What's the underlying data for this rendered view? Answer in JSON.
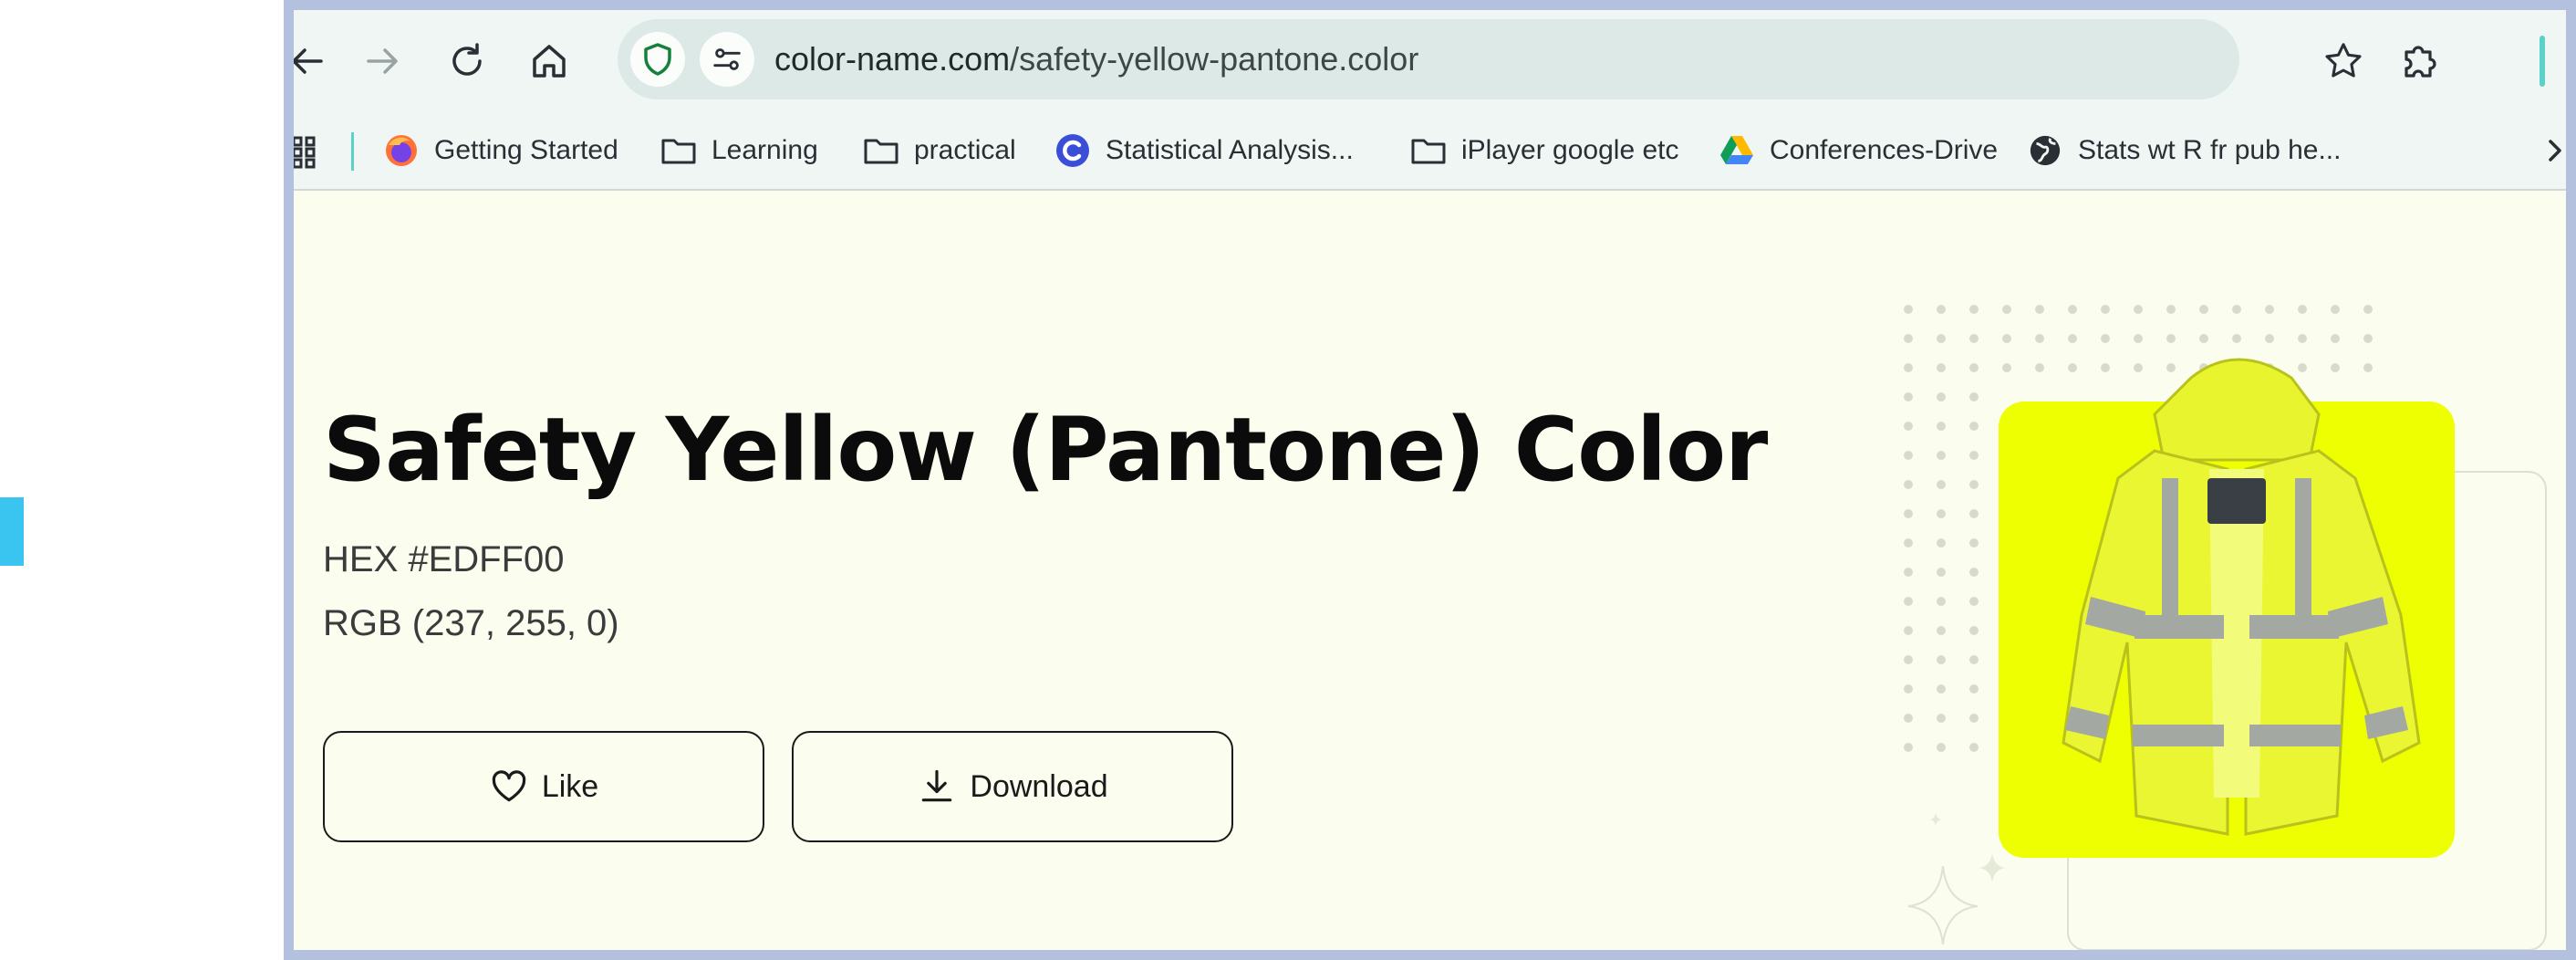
{
  "browser": {
    "url_domain": "color-name.com",
    "url_path": "/safety-yellow-pantone.color",
    "bookmarks": [
      {
        "label": "Getting Started",
        "icon": "firefox-icon"
      },
      {
        "label": "Learning",
        "icon": "folder-icon"
      },
      {
        "label": "practical",
        "icon": "folder-icon"
      },
      {
        "label": "Statistical Analysis...",
        "icon": "coursera-icon"
      },
      {
        "label": "iPlayer google etc",
        "icon": "folder-icon"
      },
      {
        "label": "Conferences-Drive",
        "icon": "google-drive-icon"
      },
      {
        "label": "Stats wt R fr pub he...",
        "icon": "globe-icon"
      }
    ]
  },
  "page": {
    "title": "Safety Yellow (Pantone) Color",
    "hex_text": "HEX #EDFF00",
    "rgb_text": "RGB (237, 255, 0)",
    "like_label": "Like",
    "download_label": "Download"
  },
  "colors": {
    "swatch": "#EDFF00",
    "page_background": "#FBFDEF",
    "frame": "#B3C1DF",
    "toolbar": "#F0F6F4",
    "accent_left": "#3AC4F0"
  }
}
